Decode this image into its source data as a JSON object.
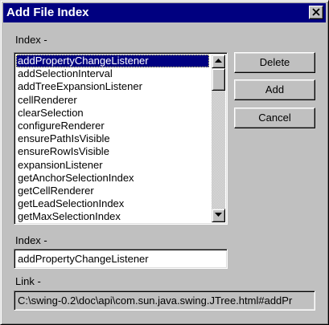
{
  "window": {
    "title": "Add File Index"
  },
  "labels": {
    "index_list": "Index -",
    "index_field": "Index -",
    "link": "Link -"
  },
  "list": {
    "items": [
      "addPropertyChangeListener",
      "addSelectionInterval",
      "addTreeExpansionListener",
      "cellRenderer",
      "clearSelection",
      "configureRenderer",
      "ensurePathIsVisible",
      "ensureRowIsVisible",
      "expansionListener",
      "getAnchorSelectionIndex",
      "getCellRenderer",
      "getLeadSelectionIndex",
      "getMaxSelectionIndex"
    ],
    "selected_index": 0
  },
  "buttons": {
    "delete": "Delete",
    "add": "Add",
    "cancel": "Cancel"
  },
  "fields": {
    "index_value": "addPropertyChangeListener",
    "link_value": "C:\\swing-0.2\\doc\\api\\com.sun.java.swing.JTree.html#addPr"
  },
  "icons": {
    "close": "close-icon",
    "scroll_up": "arrow-up-icon",
    "scroll_down": "arrow-down-icon"
  },
  "colors": {
    "titlebar": "#000080",
    "selection": "#000080",
    "face": "#c0c0c0"
  }
}
